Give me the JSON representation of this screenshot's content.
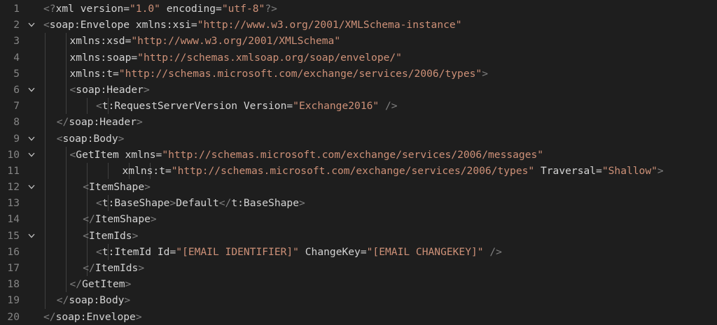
{
  "editor": {
    "lines": [
      {
        "n": "1",
        "fold": false,
        "indent": 0,
        "tokens": [
          {
            "t": "punc",
            "v": "<?"
          },
          {
            "t": "tag",
            "v": "xml"
          },
          {
            "t": "attr",
            "v": " version="
          },
          {
            "t": "str",
            "v": "\"1.0\""
          },
          {
            "t": "attr",
            "v": " encoding="
          },
          {
            "t": "str",
            "v": "\"utf-8\""
          },
          {
            "t": "punc",
            "v": "?>"
          }
        ]
      },
      {
        "n": "2",
        "fold": true,
        "indent": 0,
        "tokens": [
          {
            "t": "punc",
            "v": "<"
          },
          {
            "t": "tag",
            "v": "soap:Envelope"
          },
          {
            "t": "attr",
            "v": " xmlns:xsi="
          },
          {
            "t": "str",
            "v": "\"http://www.w3.org/2001/XMLSchema-instance\""
          }
        ]
      },
      {
        "n": "3",
        "fold": false,
        "indent": 10,
        "tokens": [
          {
            "t": "attr",
            "v": "xmlns:xsd="
          },
          {
            "t": "str",
            "v": "\"http://www.w3.org/2001/XMLSchema\""
          }
        ]
      },
      {
        "n": "4",
        "fold": false,
        "indent": 10,
        "tokens": [
          {
            "t": "attr",
            "v": "xmlns:soap="
          },
          {
            "t": "str",
            "v": "\"http://schemas.xmlsoap.org/soap/envelope/\""
          }
        ]
      },
      {
        "n": "5",
        "fold": false,
        "indent": 10,
        "tokens": [
          {
            "t": "attr",
            "v": "xmlns:t="
          },
          {
            "t": "str",
            "v": "\"http://schemas.microsoft.com/exchange/services/2006/types\""
          },
          {
            "t": "punc",
            "v": ">"
          }
        ]
      },
      {
        "n": "6",
        "fold": true,
        "indent": 10,
        "tokens": [
          {
            "t": "punc",
            "v": "<"
          },
          {
            "t": "tag",
            "v": "soap:Header"
          },
          {
            "t": "punc",
            "v": ">"
          }
        ]
      },
      {
        "n": "7",
        "fold": false,
        "indent": 20,
        "tokens": [
          {
            "t": "punc",
            "v": "<"
          },
          {
            "t": "tag",
            "v": "t:RequestServerVersion"
          },
          {
            "t": "attr",
            "v": " Version="
          },
          {
            "t": "str",
            "v": "\"Exchange2016\""
          },
          {
            "t": "punc",
            "v": " />"
          }
        ]
      },
      {
        "n": "8",
        "fold": false,
        "indent": 5,
        "tokens": [
          {
            "t": "punc",
            "v": "</"
          },
          {
            "t": "tag",
            "v": "soap:Header"
          },
          {
            "t": "punc",
            "v": ">"
          }
        ]
      },
      {
        "n": "9",
        "fold": true,
        "indent": 5,
        "tokens": [
          {
            "t": "punc",
            "v": "<"
          },
          {
            "t": "tag",
            "v": "soap:Body"
          },
          {
            "t": "punc",
            "v": ">"
          }
        ]
      },
      {
        "n": "10",
        "fold": true,
        "indent": 10,
        "tokens": [
          {
            "t": "punc",
            "v": "<"
          },
          {
            "t": "tag",
            "v": "GetItem"
          },
          {
            "t": "attr",
            "v": " xmlns="
          },
          {
            "t": "str",
            "v": "\"http://schemas.microsoft.com/exchange/services/2006/messages\""
          }
        ]
      },
      {
        "n": "11",
        "fold": false,
        "indent": 30,
        "tokens": [
          {
            "t": "attr",
            "v": "xmlns:t="
          },
          {
            "t": "str",
            "v": "\"http://schemas.microsoft.com/exchange/services/2006/types\""
          },
          {
            "t": "attr",
            "v": " Traversal="
          },
          {
            "t": "str",
            "v": "\"Shallow\""
          },
          {
            "t": "punc",
            "v": ">"
          }
        ]
      },
      {
        "n": "12",
        "fold": true,
        "indent": 15,
        "tokens": [
          {
            "t": "punc",
            "v": "<"
          },
          {
            "t": "tag",
            "v": "ItemShape"
          },
          {
            "t": "punc",
            "v": ">"
          }
        ]
      },
      {
        "n": "13",
        "fold": false,
        "indent": 20,
        "tokens": [
          {
            "t": "punc",
            "v": "<"
          },
          {
            "t": "tag",
            "v": "t:BaseShape"
          },
          {
            "t": "punc",
            "v": ">"
          },
          {
            "t": "text",
            "v": "Default"
          },
          {
            "t": "punc",
            "v": "</"
          },
          {
            "t": "tag",
            "v": "t:BaseShape"
          },
          {
            "t": "punc",
            "v": ">"
          }
        ]
      },
      {
        "n": "14",
        "fold": false,
        "indent": 15,
        "tokens": [
          {
            "t": "punc",
            "v": "</"
          },
          {
            "t": "tag",
            "v": "ItemShape"
          },
          {
            "t": "punc",
            "v": ">"
          }
        ]
      },
      {
        "n": "15",
        "fold": true,
        "indent": 15,
        "tokens": [
          {
            "t": "punc",
            "v": "<"
          },
          {
            "t": "tag",
            "v": "ItemIds"
          },
          {
            "t": "punc",
            "v": ">"
          }
        ]
      },
      {
        "n": "16",
        "fold": false,
        "indent": 20,
        "tokens": [
          {
            "t": "punc",
            "v": "<"
          },
          {
            "t": "tag",
            "v": "t:ItemId"
          },
          {
            "t": "attr",
            "v": " Id="
          },
          {
            "t": "str",
            "v": "\"[EMAIL IDENTIFIER]\""
          },
          {
            "t": "attr",
            "v": " ChangeKey="
          },
          {
            "t": "str",
            "v": "\"[EMAIL CHANGEKEY]\""
          },
          {
            "t": "punc",
            "v": " />"
          }
        ]
      },
      {
        "n": "17",
        "fold": false,
        "indent": 15,
        "tokens": [
          {
            "t": "punc",
            "v": "</"
          },
          {
            "t": "tag",
            "v": "ItemIds"
          },
          {
            "t": "punc",
            "v": ">"
          }
        ]
      },
      {
        "n": "18",
        "fold": false,
        "indent": 10,
        "tokens": [
          {
            "t": "punc",
            "v": "</"
          },
          {
            "t": "tag",
            "v": "GetItem"
          },
          {
            "t": "punc",
            "v": ">"
          }
        ]
      },
      {
        "n": "19",
        "fold": false,
        "indent": 5,
        "tokens": [
          {
            "t": "punc",
            "v": "</"
          },
          {
            "t": "tag",
            "v": "soap:Body"
          },
          {
            "t": "punc",
            "v": ">"
          }
        ]
      },
      {
        "n": "20",
        "fold": false,
        "indent": 0,
        "tokens": [
          {
            "t": "punc",
            "v": "</"
          },
          {
            "t": "tag",
            "v": "soap:Envelope"
          },
          {
            "t": "punc",
            "v": ">"
          }
        ]
      }
    ]
  },
  "colors": {
    "background": "#1e1e1e",
    "line_number": "#858585",
    "tag": "#d4d4d4",
    "string": "#ce9178",
    "punctuation": "#808080"
  },
  "icons": {
    "fold": "chevron-down-icon"
  }
}
